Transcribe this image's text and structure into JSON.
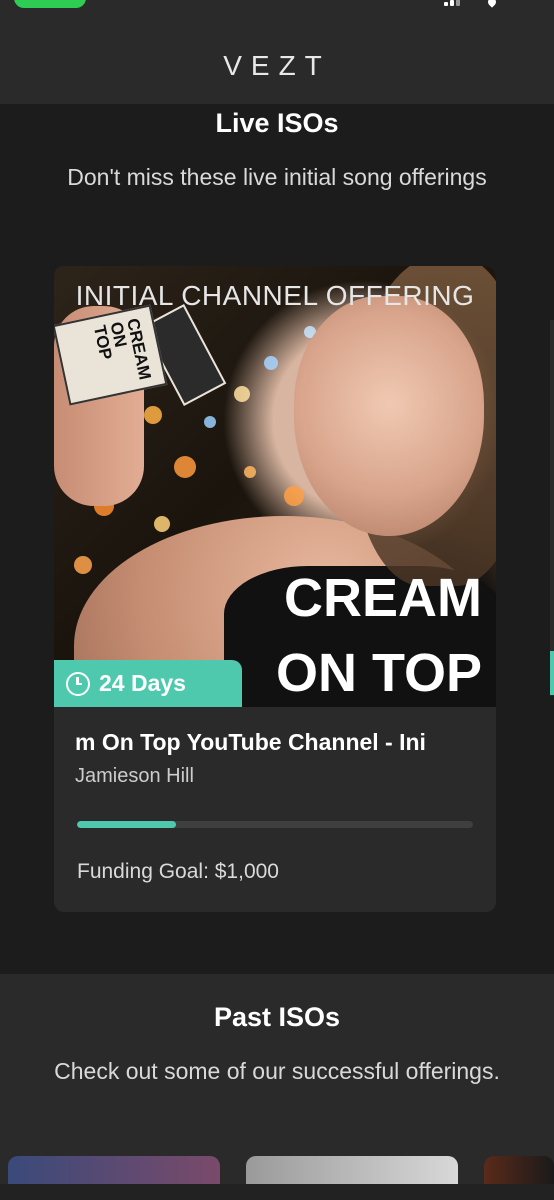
{
  "header": {
    "brand": "VEZT"
  },
  "live": {
    "title": "Live ISOs",
    "subtitle": "Don't miss these live initial song offerings",
    "cards": [
      {
        "image_caption": "INITIAL CHANNEL OFFERING",
        "image_big_line1": "CREAM",
        "image_big_line2": "ON TOP",
        "can_text": "CREAM ON TOP",
        "days_left": "24 Days",
        "title": "m On Top YouTube Channel - Ini",
        "artist": "Jamieson Hill",
        "progress": 0.25,
        "funding_label": "Funding Goal: $1,000"
      }
    ]
  },
  "past": {
    "title": "Past ISOs",
    "subtitle": "Check out some of our successful offerings."
  },
  "colors": {
    "accent": "#4ec9ae",
    "background": "#1c1c1c",
    "card": "#2a2a2a"
  },
  "icons": {
    "days_icon": "clock-icon"
  }
}
